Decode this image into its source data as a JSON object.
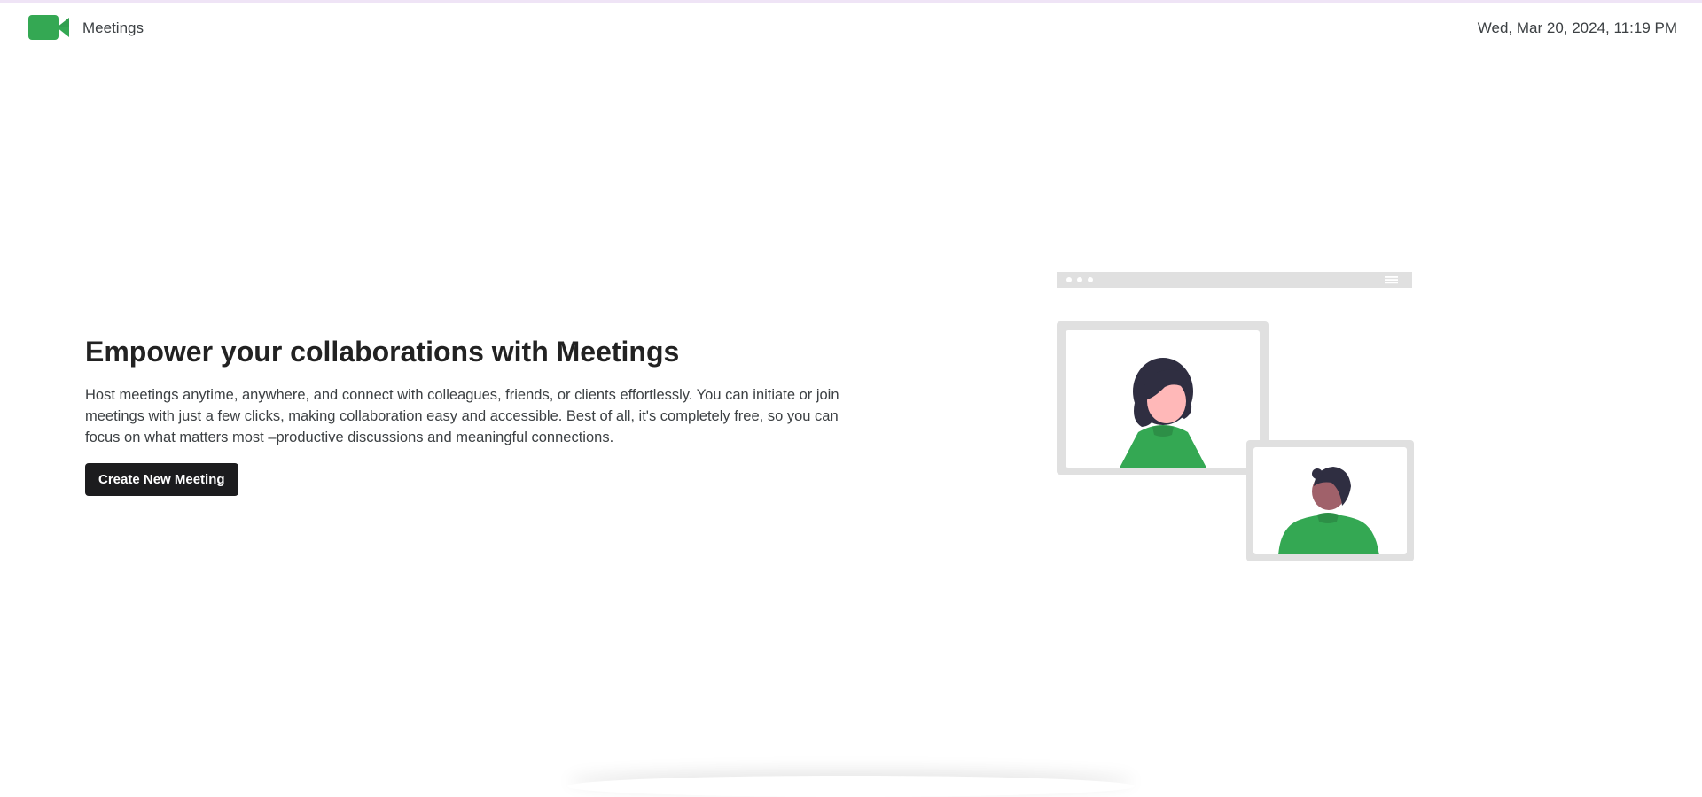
{
  "header": {
    "app_name": "Meetings",
    "datetime": "Wed, Mar 20, 2024, 11:19 PM",
    "logo_icon": "video-camera-icon",
    "brand_color": "#34a853"
  },
  "hero": {
    "title": "Empower your collaborations with Meetings",
    "description": "Host meetings anytime, anywhere, and connect with colleagues, friends, or clients effortlessly. You can initiate or join meetings with just a few clicks, making collaboration easy and accessible. Best of all, it's completely free, so you can focus on what matters most –productive discussions and meaningful connections.",
    "cta_label": "Create New Meeting"
  },
  "illustration": {
    "subject": "video-call-illustration",
    "frame_color": "#e0e0e0",
    "accent_color": "#34a853"
  }
}
